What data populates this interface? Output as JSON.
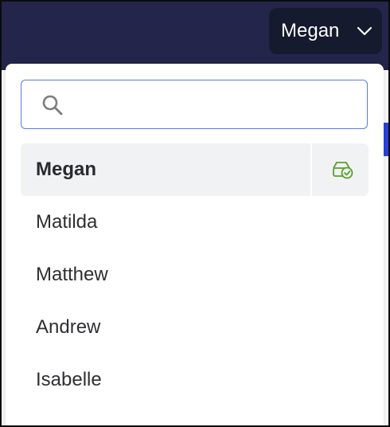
{
  "header": {
    "current_user": "Megan"
  },
  "dropdown": {
    "search": {
      "value": "",
      "placeholder": ""
    },
    "users": [
      {
        "name": "Megan",
        "selected": true
      },
      {
        "name": "Matilda",
        "selected": false
      },
      {
        "name": "Matthew",
        "selected": false
      },
      {
        "name": "Andrew",
        "selected": false
      },
      {
        "name": "Isabelle",
        "selected": false
      }
    ]
  },
  "icons": {
    "switcher": "chevron-down-icon",
    "search": "search-icon",
    "selected_user_action": "drive-check-icon"
  },
  "colors": {
    "topbar": "#23264a",
    "switcher_bg": "#161a2e",
    "search_border": "#5b7be0",
    "selected_row_bg": "#f1f2f4",
    "check_green": "#5aa02c",
    "accent_blue": "#2b45e0"
  }
}
